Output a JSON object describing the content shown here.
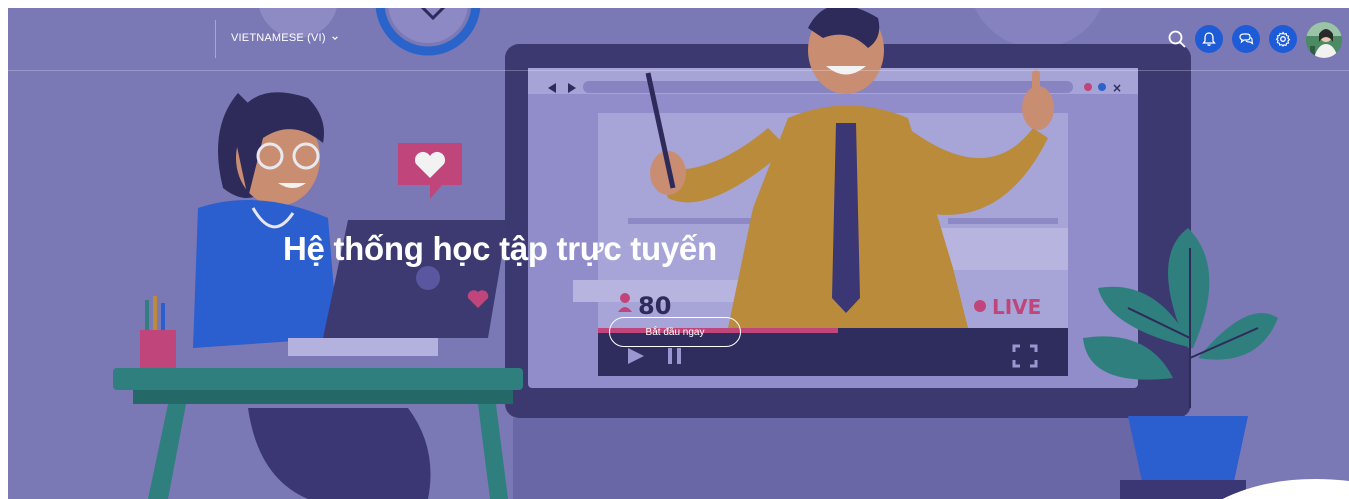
{
  "header": {
    "language_label": "VIETNAMESE (VI)",
    "icons": [
      "search-icon",
      "bell-icon",
      "chat-icon",
      "gear-icon"
    ]
  },
  "hero": {
    "title": "Hệ thống học tập trực tuyến",
    "cta_label": "Bắt đầu ngay",
    "viewer_count": "80",
    "live_label": "LIVE"
  },
  "colors": {
    "overlay": "#7b78b6",
    "button_blue": "#1e5bd6",
    "text": "#ffffff"
  }
}
